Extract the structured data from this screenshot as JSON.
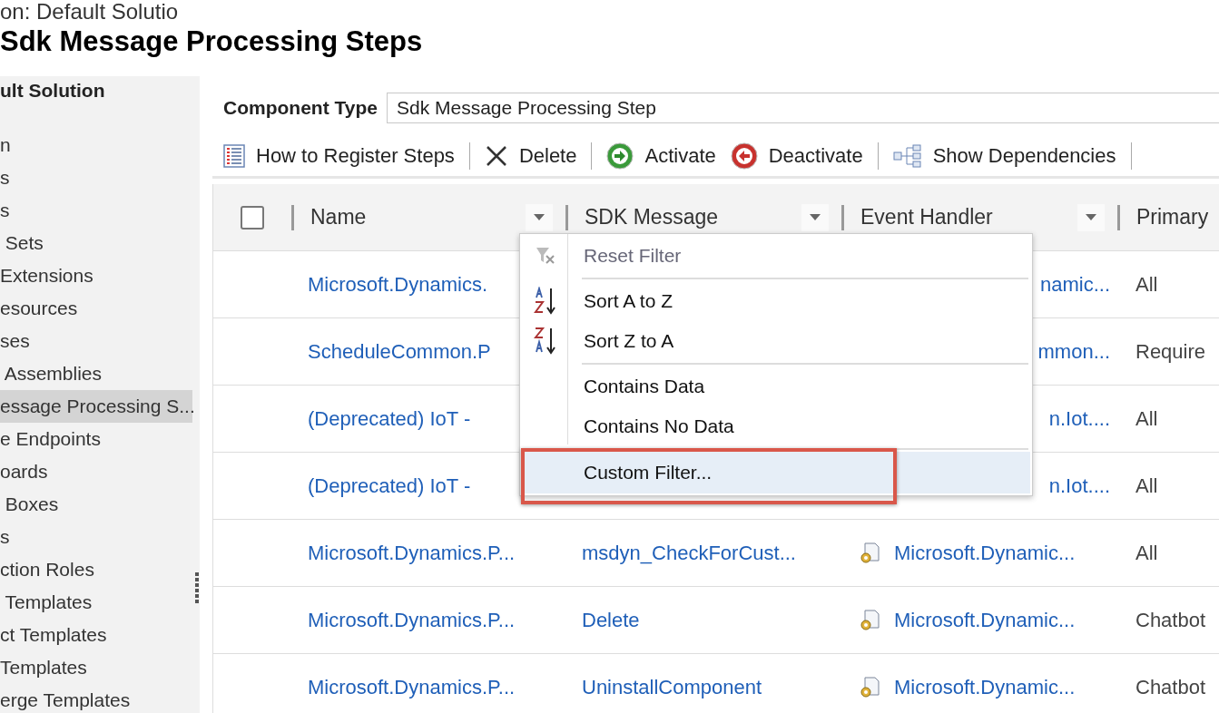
{
  "header": {
    "breadcrumb": "on: Default Solutio",
    "title": "Sdk Message Processing Steps"
  },
  "sidebar": {
    "heading": "ult Solution",
    "items": [
      {
        "label": "n",
        "selected": false
      },
      {
        "label": "s",
        "selected": false
      },
      {
        "label": "s",
        "selected": false
      },
      {
        "label": " Sets",
        "selected": false
      },
      {
        "label": "Extensions",
        "selected": false
      },
      {
        "label": "esources",
        "selected": false
      },
      {
        "label": "ses",
        "selected": false
      },
      {
        "label": " Assemblies",
        "selected": false
      },
      {
        "label": "essage Processing S...",
        "selected": true
      },
      {
        "label": "e Endpoints",
        "selected": false
      },
      {
        "label": "oards",
        "selected": false
      },
      {
        "label": " Boxes",
        "selected": false
      },
      {
        "label": "s",
        "selected": false
      },
      {
        "label": "ction Roles",
        "selected": false
      },
      {
        "label": " Templates",
        "selected": false
      },
      {
        "label": "ct Templates",
        "selected": false
      },
      {
        "label": "Templates",
        "selected": false
      },
      {
        "label": "erge Templates",
        "selected": false
      }
    ]
  },
  "component_type": {
    "label": "Component Type",
    "value": "Sdk Message Processing Step"
  },
  "toolbar": [
    {
      "kind": "register",
      "label": "How to Register Steps"
    },
    {
      "kind": "separator"
    },
    {
      "kind": "delete",
      "label": "Delete"
    },
    {
      "kind": "separator"
    },
    {
      "kind": "activate",
      "label": "Activate"
    },
    {
      "kind": "deactivate",
      "label": "Deactivate"
    },
    {
      "kind": "separator"
    },
    {
      "kind": "dependencies",
      "label": "Show Dependencies"
    },
    {
      "kind": "separator"
    }
  ],
  "grid": {
    "select_all": {
      "checked": false
    },
    "columns": [
      {
        "label": "Name",
        "filter": true
      },
      {
        "label": "SDK Message",
        "filter": true
      },
      {
        "label": "Event Handler",
        "filter": true
      },
      {
        "label": "Primary",
        "filter": false
      }
    ],
    "rows": [
      {
        "name": "Microsoft.Dynamics.",
        "handler": "namic...",
        "handler_icon": false,
        "primary": "All"
      },
      {
        "name": "ScheduleCommon.P",
        "handler": "mmon...",
        "handler_icon": false,
        "primary": "Require"
      },
      {
        "name": " (Deprecated) IoT -",
        "handler": "n.Iot....",
        "handler_icon": false,
        "primary": "All"
      },
      {
        "name": "(Deprecated) IoT -",
        "handler": "n.Iot....",
        "handler_icon": false,
        "primary": "All"
      },
      {
        "name": "Microsoft.Dynamics.P...",
        "message": "msdyn_CheckForCust...",
        "handler": "Microsoft.Dynamic...",
        "handler_icon": true,
        "primary": "All"
      },
      {
        "name": "Microsoft.Dynamics.P...",
        "message": "Delete",
        "handler": "Microsoft.Dynamic...",
        "handler_icon": true,
        "primary": "Chatbot"
      },
      {
        "name": "Microsoft.Dynamics.P...",
        "message": "UninstallComponent",
        "handler": "Microsoft.Dynamic...",
        "handler_icon": true,
        "primary": "Chatbot"
      }
    ]
  },
  "column_menu": {
    "items": [
      {
        "kind": "reset",
        "label": "Reset Filter",
        "disabled": true,
        "selected": false
      },
      {
        "kind": "separator"
      },
      {
        "kind": "sort-asc",
        "label": "Sort A to Z",
        "disabled": false,
        "selected": false
      },
      {
        "kind": "sort-desc",
        "label": "Sort Z to A",
        "disabled": false,
        "selected": false
      },
      {
        "kind": "separator"
      },
      {
        "kind": "plain",
        "label": "Contains Data",
        "disabled": false,
        "selected": false
      },
      {
        "kind": "plain",
        "label": "Contains No Data",
        "disabled": false,
        "selected": false
      },
      {
        "kind": "separator"
      },
      {
        "kind": "plain",
        "label": "Custom Filter...",
        "disabled": false,
        "selected": true
      }
    ]
  }
}
